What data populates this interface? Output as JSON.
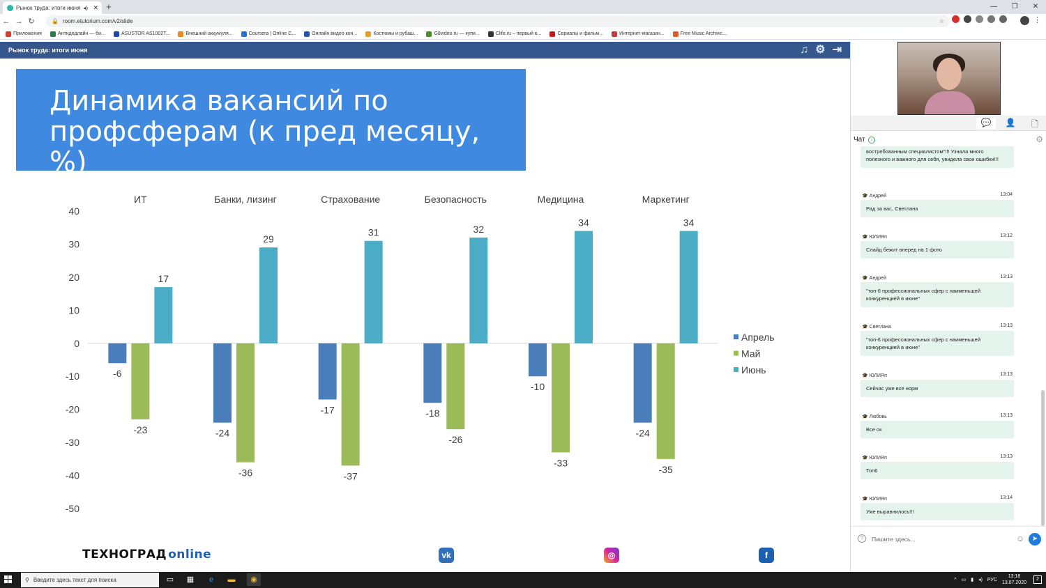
{
  "browser": {
    "tab_title": "Рынок труда: итоги июня",
    "url": "room.etutorium.com/v2/slide",
    "bookmarks": [
      {
        "label": "Приложения",
        "color": "#d23f31"
      },
      {
        "label": "Антидедлайн — би...",
        "color": "#2b7a4b"
      },
      {
        "label": "ASUSTOR AS1002T...",
        "color": "#1a47b0"
      },
      {
        "label": "Внешний аккумуля...",
        "color": "#f08a1c"
      },
      {
        "label": "Coursera | Online C...",
        "color": "#2a73cc"
      },
      {
        "label": "Онлайн видео кон...",
        "color": "#2855a8"
      },
      {
        "label": "Костюмы и рубаш...",
        "color": "#e3a22b"
      },
      {
        "label": "G8video.ru — купи...",
        "color": "#4d8a2e"
      },
      {
        "label": "Clife.ru – первый в...",
        "color": "#333333"
      },
      {
        "label": "Сериалы и фильм...",
        "color": "#c41e1e"
      },
      {
        "label": "Интернет-магазин...",
        "color": "#c43a3a"
      },
      {
        "label": "Free Music Archive:...",
        "color": "#e35a2a"
      }
    ]
  },
  "app": {
    "header_title": "Рынок труда: итоги июня",
    "icons": [
      "music-icon",
      "gear-icon",
      "exit-icon"
    ]
  },
  "slide": {
    "title": "Динамика вакансий по профсферам (к пред месяцу, %)",
    "logo_main": "ТЕХНОГРАД",
    "logo_suffix": "online",
    "social": [
      "vk-icon",
      "instagram-icon",
      "facebook-icon"
    ]
  },
  "chart_data": {
    "type": "bar",
    "categories": [
      "ИТ",
      "Банки, лизинг",
      "Страхование",
      "Безопасность",
      "Медицина",
      "Маркетинг"
    ],
    "series": [
      {
        "name": "Апрель",
        "color": "#4a7ebb",
        "values": [
          -6,
          -24,
          -17,
          -18,
          -10,
          -24
        ]
      },
      {
        "name": "Май",
        "color": "#9bbb59",
        "values": [
          -23,
          -36,
          -37,
          -26,
          -33,
          -35
        ]
      },
      {
        "name": "Июнь",
        "color": "#4bacc6",
        "values": [
          17,
          29,
          31,
          32,
          34,
          34
        ]
      }
    ],
    "ylim": [
      -50,
      40
    ],
    "yticks": [
      40,
      30,
      20,
      10,
      0,
      -10,
      -20,
      -30,
      -40,
      -50
    ],
    "legend": "right",
    "grid": false,
    "categories_position": "top"
  },
  "chat": {
    "label": "Чат",
    "messages": [
      {
        "author": "",
        "time": "",
        "text": "востребованным специалистом\"!!! Узнала много полезного и важного для себя, увидела свои ошибки!!!"
      },
      {
        "author": "Андрей",
        "time": "13:04",
        "text": "Рад за вас, Светлана"
      },
      {
        "author": "ЮЛИЯп",
        "time": "13:12",
        "text": "Слайд бежит вперед на 1 фото"
      },
      {
        "author": "Андрей",
        "time": "13:13",
        "text": "\"топ-6 профессиональных сфер с наименьшей конкуренцией в июне\""
      },
      {
        "author": "Светлана",
        "time": "13:13",
        "text": "\"топ-6 профессиональных сфер с наименьшей конкуренцией в июне\""
      },
      {
        "author": "ЮЛИЯп",
        "time": "13:13",
        "text": "Сейчас уже все норм"
      },
      {
        "author": "Любовь",
        "time": "13:13",
        "text": "Все ок"
      },
      {
        "author": "ЮЛИЯп",
        "time": "13:13",
        "text": "Топ6"
      },
      {
        "author": "ЮЛИЯп",
        "time": "13:14",
        "text": "Уже выравнилось!!!"
      }
    ],
    "input_placeholder": "Пишите здесь..."
  },
  "taskbar": {
    "search_placeholder": "Введите здесь текст для поиска",
    "lang": "РУС",
    "time": "13:18",
    "date": "13.07.2020",
    "notifications": "2"
  }
}
